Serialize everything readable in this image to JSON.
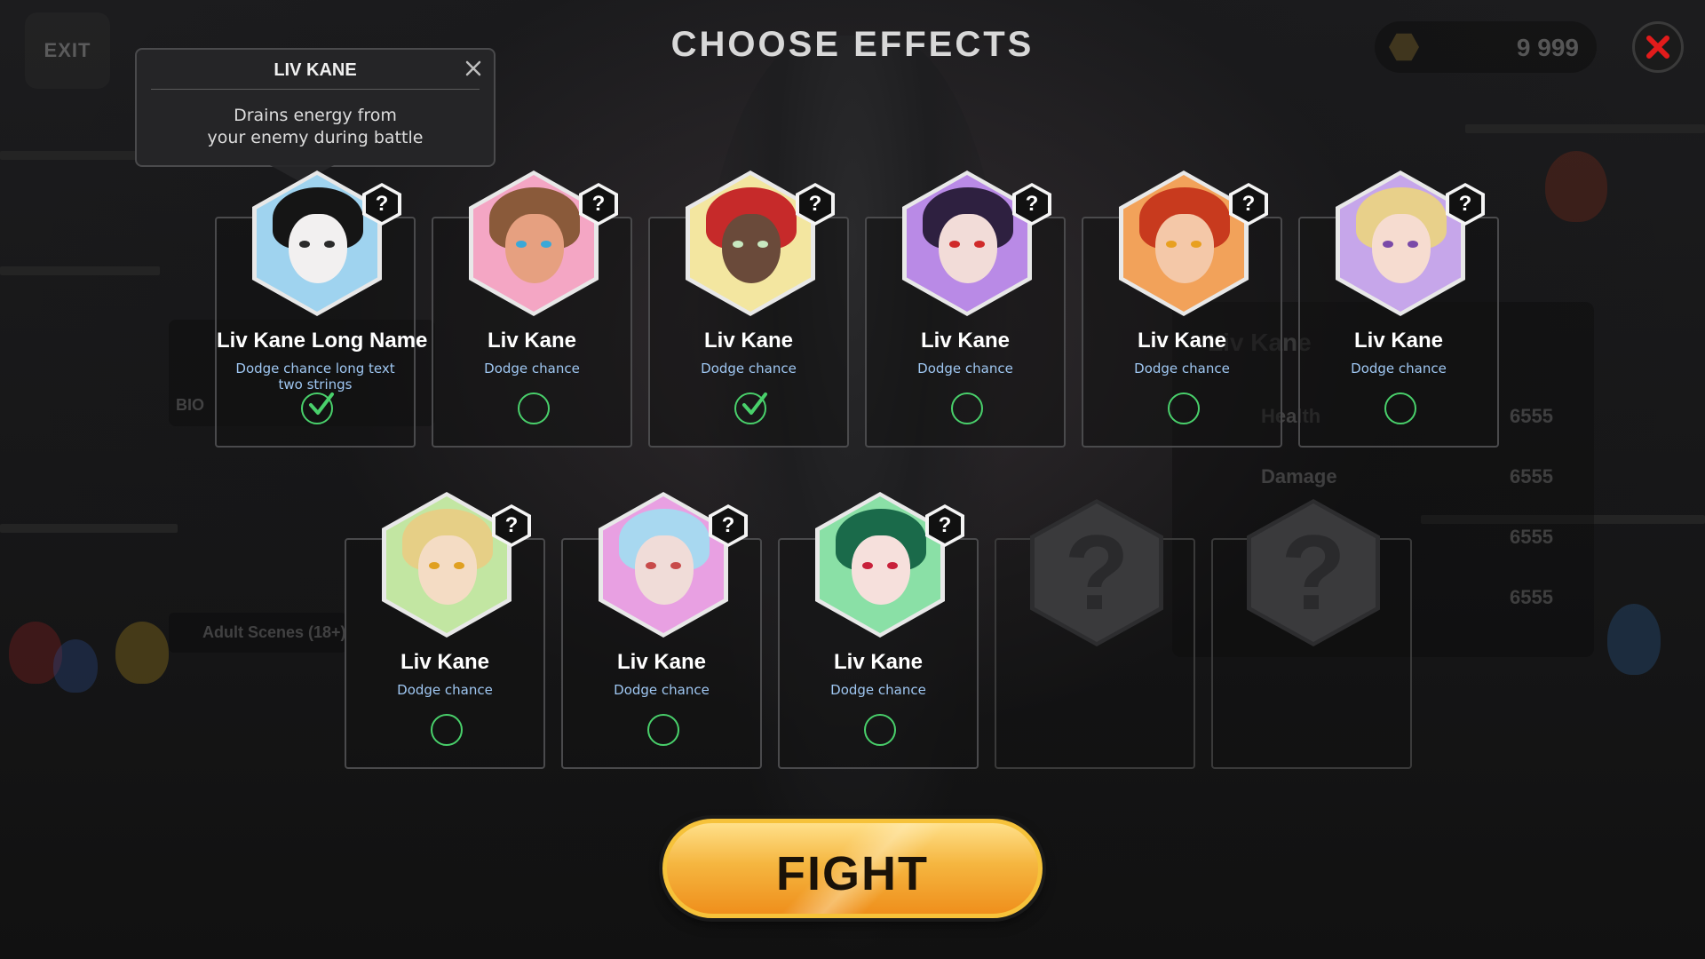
{
  "header": {
    "title": "CHOOSE EFFECTS",
    "exit_label": "EXIT",
    "currency_amount": "9 999"
  },
  "tooltip": {
    "title": "LIV KANE",
    "text_line1": "Drains energy from",
    "text_line2": "your enemy during battle"
  },
  "background": {
    "bio_label": "BIO",
    "adult_label": "Adult Scenes (18+)",
    "panel_name": "Liv Kane",
    "stats": [
      {
        "label": "Health",
        "value": "6555"
      },
      {
        "label": "Damage",
        "value": "6555"
      },
      {
        "label": "",
        "value": "6555"
      },
      {
        "label": "",
        "value": "6555"
      }
    ]
  },
  "cards": [
    {
      "name": "Liv Kane Long Name",
      "effect": "Dodge chance long text two strings",
      "selected": true,
      "palette": {
        "bg": "#9fd3ef",
        "hair": "#151515",
        "face": "#f2f0f0",
        "eye": "#2a2a2a"
      }
    },
    {
      "name": "Liv Kane",
      "effect": "Dodge chance",
      "selected": false,
      "palette": {
        "bg": "#f4a6c4",
        "hair": "#8a5a3a",
        "face": "#e6a080",
        "eye": "#3aa8d8"
      }
    },
    {
      "name": "Liv Kane",
      "effect": "Dodge chance",
      "selected": true,
      "palette": {
        "bg": "#f3e6a0",
        "hair": "#c62a2a",
        "face": "#6a4a3a",
        "eye": "#c8e8c0"
      }
    },
    {
      "name": "Liv Kane",
      "effect": "Dodge chance",
      "selected": false,
      "palette": {
        "bg": "#b98ae6",
        "hair": "#2e2040",
        "face": "#f2dcd8",
        "eye": "#d02a2a"
      }
    },
    {
      "name": "Liv Kane",
      "effect": "Dodge chance",
      "selected": false,
      "palette": {
        "bg": "#f2a25a",
        "hair": "#c83a1e",
        "face": "#f4c8a8",
        "eye": "#e8a020"
      }
    },
    {
      "name": "Liv Kane",
      "effect": "Dodge chance",
      "selected": false,
      "palette": {
        "bg": "#c6a6ea",
        "hair": "#e8d08a",
        "face": "#f6dcd0",
        "eye": "#7a4aa8"
      }
    },
    {
      "name": "Liv Kane",
      "effect": "Dodge chance",
      "selected": false,
      "palette": {
        "bg": "#c2e6a2",
        "hair": "#e6cf86",
        "face": "#f4dcc4",
        "eye": "#e0a020"
      }
    },
    {
      "name": "Liv Kane",
      "effect": "Dodge chance",
      "selected": false,
      "palette": {
        "bg": "#e8a0e2",
        "hair": "#a8d8f0",
        "face": "#f0dcd8",
        "eye": "#c84a4a"
      }
    },
    {
      "name": "Liv Kane",
      "effect": "Dodge chance",
      "selected": false,
      "palette": {
        "bg": "#8ae0a6",
        "hair": "#1a6a4a",
        "face": "#f6e0dc",
        "eye": "#c8203a"
      }
    }
  ],
  "locked_slots": [
    "?",
    "?"
  ],
  "fight_label": "FIGHT",
  "colors": {
    "accent_select": "#49d06b",
    "effect_text": "#9fc7f2",
    "fight_gradient_top": "#ffe08a",
    "fight_gradient_bottom": "#ef8f1c",
    "close_red": "#e21b1b"
  }
}
